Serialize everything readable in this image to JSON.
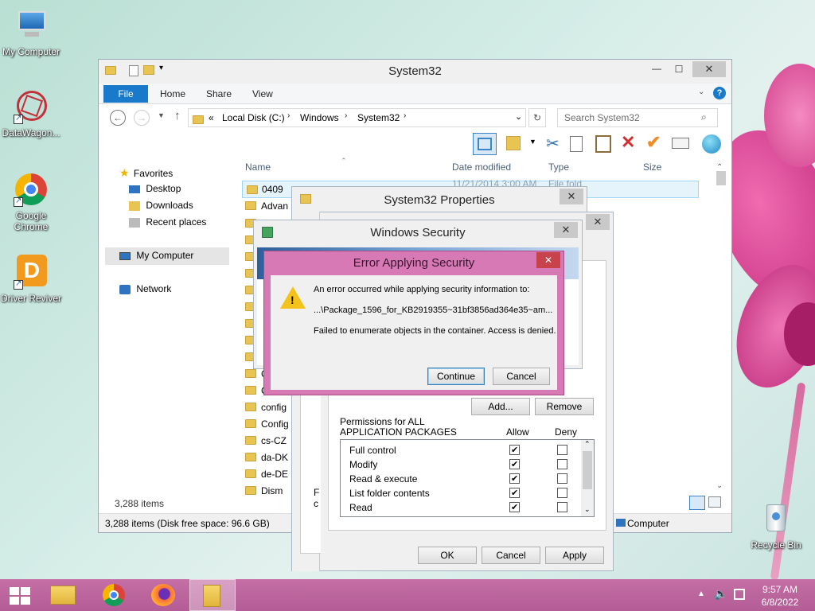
{
  "desktop": {
    "icons": [
      {
        "label": "My Computer"
      },
      {
        "label": "DataWagon..."
      },
      {
        "label": "Google Chrome"
      },
      {
        "label": "Driver Reviver"
      },
      {
        "label": "Recycle Bin"
      }
    ]
  },
  "explorer": {
    "title": "System32",
    "ribbon_tabs": [
      "File",
      "Home",
      "Share",
      "View"
    ],
    "breadcrumb": [
      "«",
      "Local Disk (C:)",
      "Windows",
      "System32"
    ],
    "search_placeholder": "Search System32",
    "nav": {
      "favorites": "Favorites",
      "desktop": "Desktop",
      "downloads": "Downloads",
      "recent": "Recent places",
      "my_computer": "My Computer",
      "network": "Network"
    },
    "columns": [
      "Name",
      "Date modified",
      "Type",
      "Size"
    ],
    "files": [
      "0409",
      "Advan",
      "",
      "",
      "",
      "",
      "",
      "",
      "",
      "",
      "",
      "C",
      "C",
      "config",
      "Config",
      "cs-CZ",
      "da-DK",
      "de-DE",
      "Dism"
    ],
    "first_row_date": "11/21/2014 3:00 AM",
    "first_row_type": "File fold",
    "item_count": "3,288 items",
    "status": "3,288 items (Disk free space: 96.6 GB)",
    "status_right": "Computer"
  },
  "properties": {
    "title": "System32 Properties",
    "add_label": "Add...",
    "remove_label": "Remove",
    "permissions_header_line1": "Permissions for ALL",
    "permissions_header_line2": "APPLICATION PACKAGES",
    "allow_label": "Allow",
    "deny_label": "Deny",
    "permissions": [
      {
        "name": "Full control",
        "allow": true,
        "deny": false
      },
      {
        "name": "Modify",
        "allow": true,
        "deny": false
      },
      {
        "name": "Read & execute",
        "allow": true,
        "deny": false
      },
      {
        "name": "List folder contents",
        "allow": true,
        "deny": false
      },
      {
        "name": "Read",
        "allow": true,
        "deny": false
      }
    ],
    "frag_f": "F",
    "frag_c": "c",
    "ok_label": "OK",
    "cancel_label": "Cancel",
    "apply_label": "Apply"
  },
  "security": {
    "title": "Windows Security"
  },
  "error": {
    "title": "Error Applying Security",
    "line1": "An error occurred while applying security information to:",
    "line2": "...\\Package_1596_for_KB2919355~31bf3856ad364e35~am...",
    "line3": "Failed to enumerate objects in the container. Access is denied.",
    "continue_label": "Continue",
    "cancel_label": "Cancel"
  },
  "taskbar": {
    "time": "9:57 AM",
    "date": "6/8/2022"
  },
  "colors": {
    "taskbar": "#c06aa0",
    "error_frame": "#d779b5",
    "ribbon_blue": "#1979ca"
  }
}
